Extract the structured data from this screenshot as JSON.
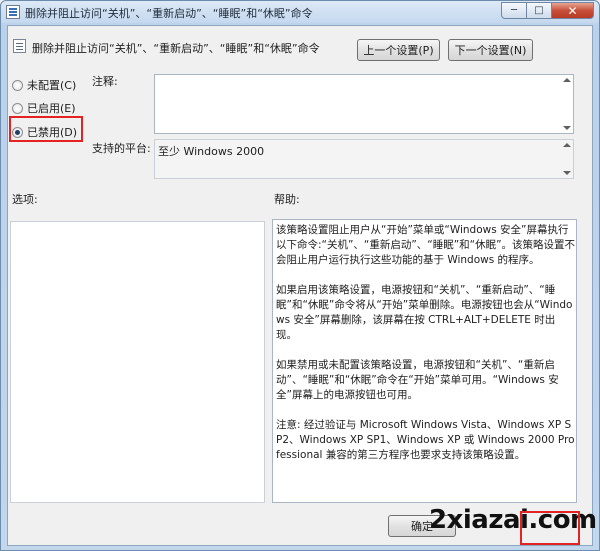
{
  "window": {
    "title": "删除并阻止访问“关机”、“重新启动”、“睡眠”和“休眠”命令"
  },
  "header": {
    "policy_name": "删除并阻止访问“关机”、“重新启动”、“睡眠”和“休眠”命令",
    "prev_button": "上一个设置(P)",
    "next_button": "下一个设置(N)"
  },
  "options": {
    "not_configured": "未配置(C)",
    "enabled": "已启用(E)",
    "disabled": "已禁用(D)",
    "selected": "disabled"
  },
  "comment": {
    "label": "注释:",
    "value": ""
  },
  "supported": {
    "label": "支持的平台:",
    "value": "至少 Windows 2000"
  },
  "sections": {
    "options_label": "选项:",
    "help_label": "帮助:"
  },
  "help": {
    "paragraphs": [
      "该策略设置阻止用户从“开始”菜单或“Windows 安全”屏幕执行以下命令:“关机”、“重新启动”、“睡眠”和“休眠”。该策略设置不会阻止用户运行执行这些功能的基于 Windows 的程序。",
      "如果启用该策略设置，电源按钮和“关机”、“重新启动”、“睡眠”和“休眠”命令将从“开始”菜单删除。电源按钮也会从“Windows 安全”屏幕删除，该屏幕在按 CTRL+ALT+DELETE 时出现。",
      "如果禁用或未配置该策略设置，电源按钮和“关机”、“重新启动”、“睡眠”和“休眠”命令在“开始”菜单可用。“Windows 安全”屏幕上的电源按钮也可用。",
      "注意: 经过验证与 Microsoft Windows Vista、Windows XP SP2、Windows XP SP1、Windows XP 或 Windows 2000 Professional 兼容的第三方程序也要求支持该策略设置。"
    ]
  },
  "footer": {
    "ok_button": "确定",
    "watermark": "2xiazai.com"
  },
  "colors": {
    "highlight": "#e32323"
  }
}
